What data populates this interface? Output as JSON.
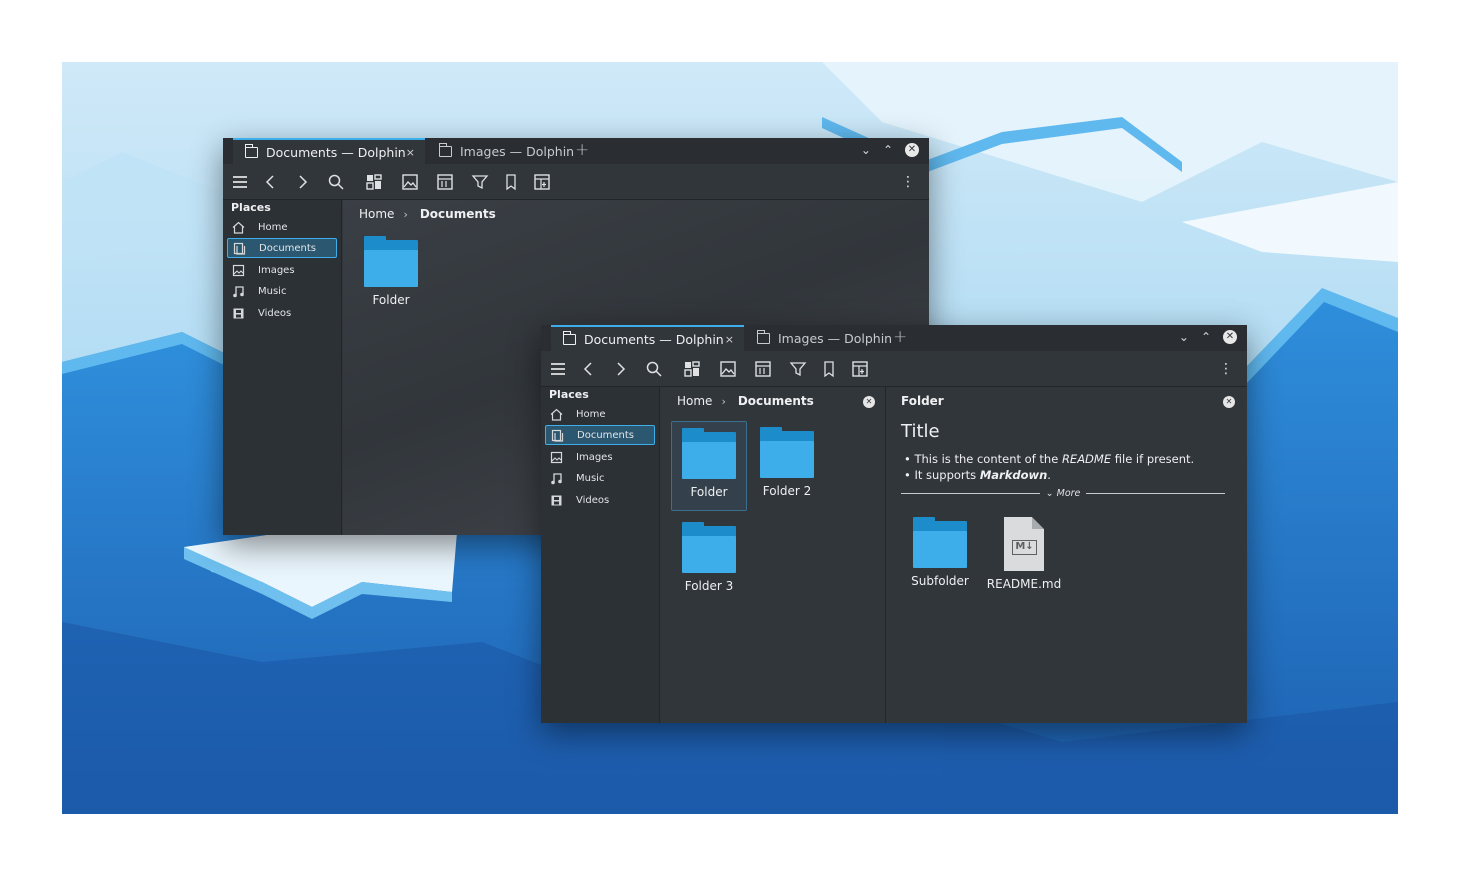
{
  "colors": {
    "accent": "#3daee9",
    "window_bg": "#31363b",
    "folder_blue": "#3daee9",
    "wallpaper_blue": "#2a8ad8"
  },
  "window1": {
    "tabs": [
      {
        "label": "Documents — Dolphin",
        "active": true,
        "close": "×"
      },
      {
        "label": "Images — Dolphin",
        "active": false
      }
    ],
    "add_tab": "+",
    "window_controls": {
      "minimize": "⌄",
      "maximize": "⌃",
      "close": "✕"
    },
    "toolbar_icons": [
      "menu-icon",
      "back-icon",
      "forward-icon",
      "search-icon",
      "icon-view-icon",
      "preview-icon",
      "details-view-icon",
      "filter-icon",
      "bookmark-icon",
      "split-view-icon"
    ],
    "toolbar_more": "⋮",
    "sidebar": {
      "title": "Places",
      "items": [
        {
          "label": "Home",
          "icon": "home-icon"
        },
        {
          "label": "Documents",
          "icon": "documents-icon",
          "active": true
        },
        {
          "label": "Images",
          "icon": "images-icon"
        },
        {
          "label": "Music",
          "icon": "music-icon"
        },
        {
          "label": "Videos",
          "icon": "videos-icon"
        }
      ]
    },
    "breadcrumb": {
      "home": "Home",
      "sep": "›",
      "current": "Documents"
    },
    "items": [
      {
        "label": "Folder",
        "icon": "folder-icon"
      }
    ]
  },
  "window2": {
    "tabs": [
      {
        "label": "Documents — Dolphin",
        "active": true,
        "close": "×"
      },
      {
        "label": "Images — Dolphin",
        "active": false
      }
    ],
    "add_tab": "+",
    "window_controls": {
      "minimize": "⌄",
      "maximize": "⌃",
      "close": "✕"
    },
    "toolbar_more": "⋮",
    "sidebar": {
      "title": "Places",
      "items": [
        {
          "label": "Home",
          "icon": "home-icon"
        },
        {
          "label": "Documents",
          "icon": "documents-icon",
          "active": true
        },
        {
          "label": "Images",
          "icon": "images-icon"
        },
        {
          "label": "Music",
          "icon": "music-icon"
        },
        {
          "label": "Videos",
          "icon": "videos-icon"
        }
      ]
    },
    "breadcrumb": {
      "home": "Home",
      "sep": "›",
      "current": "Documents",
      "close": "✕"
    },
    "items": [
      {
        "label": "Folder",
        "icon": "folder-icon",
        "selected": true
      },
      {
        "label": "Folder 2",
        "icon": "folder-icon"
      },
      {
        "label": "Folder 3",
        "icon": "folder-icon"
      }
    ],
    "info_panel": {
      "title": "Folder",
      "close": "✕",
      "readme_title": "Title",
      "readme_line1": {
        "before": "This is the content of the ",
        "emph": "README",
        "after": " file if present."
      },
      "readme_line2": {
        "before": "It supports ",
        "emph": "Markdown",
        "after": "."
      },
      "more": "More",
      "more_chevron": "⌄",
      "files": [
        {
          "label": "Subfolder",
          "icon": "folder-icon"
        },
        {
          "label": "README.md",
          "icon": "markdown-file-icon",
          "mark": "M↓"
        }
      ]
    }
  }
}
